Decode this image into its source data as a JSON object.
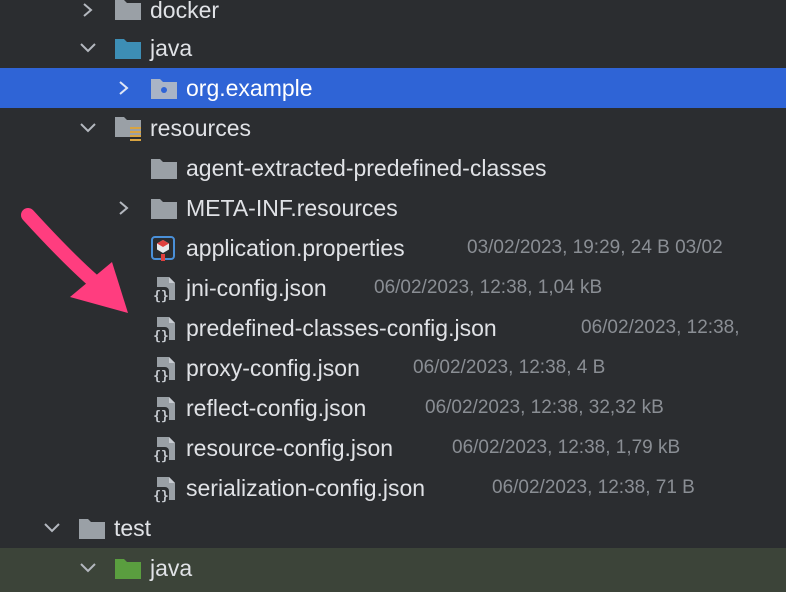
{
  "colors": {
    "background": "#2b2d30",
    "selection": "#2f64d6",
    "test_java_row": "#3c4439",
    "folder_grey": "#9aa0a6",
    "java_source_folder": "#3d8eb5",
    "java_test_folder": "#5a9e3f",
    "resources_marker": "#d9a441",
    "annotation_arrow": "#ff3d7f"
  },
  "tree": {
    "docker": {
      "label": "docker",
      "icon": "folder-icon",
      "expanded": false
    },
    "java": {
      "label": "java",
      "icon": "source-folder-icon",
      "expanded": true
    },
    "org_example": {
      "label": "org.example",
      "icon": "package-icon",
      "expanded": false,
      "selected": true
    },
    "resources": {
      "label": "resources",
      "icon": "resources-folder-icon",
      "expanded": true
    },
    "agent_classes": {
      "label": "agent-extracted-predefined-classes",
      "icon": "folder-icon"
    },
    "meta_inf": {
      "label": "META-INF.resources",
      "icon": "folder-icon",
      "expanded": false
    },
    "files": [
      {
        "name": "application.properties",
        "meta": "03/02/2023, 19:29, 24 B 03/02",
        "icon": "properties-file-icon"
      },
      {
        "name": "jni-config.json",
        "meta": "06/02/2023, 12:38, 1,04 kB",
        "icon": "json-file-icon"
      },
      {
        "name": "predefined-classes-config.json",
        "meta": "06/02/2023, 12:38,",
        "icon": "json-file-icon"
      },
      {
        "name": "proxy-config.json",
        "meta": "06/02/2023, 12:38, 4 B",
        "icon": "json-file-icon"
      },
      {
        "name": "reflect-config.json",
        "meta": "06/02/2023, 12:38, 32,32 kB",
        "icon": "json-file-icon"
      },
      {
        "name": "resource-config.json",
        "meta": "06/02/2023, 12:38, 1,79 kB",
        "icon": "json-file-icon"
      },
      {
        "name": "serialization-config.json",
        "meta": "06/02/2023, 12:38, 71 B",
        "icon": "json-file-icon"
      }
    ],
    "test": {
      "label": "test",
      "icon": "folder-icon",
      "expanded": true
    },
    "test_java": {
      "label": "java",
      "icon": "test-source-folder-icon",
      "expanded": true
    }
  }
}
